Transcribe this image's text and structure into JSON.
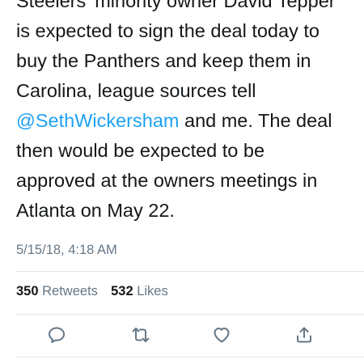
{
  "tweet": {
    "lines": [
      {
        "text": "Steelers' minority owner David Tepper"
      },
      {
        "text": "is expected to sign the deal today to"
      },
      {
        "text": "buy the Panthers and keep them in"
      },
      {
        "text": "Carolina, league sources tell"
      },
      {
        "mention": "@SethWickersham",
        "after": " and me. The deal"
      },
      {
        "text": "then would be expected to be"
      },
      {
        "text": "approved at the owners meetings in"
      },
      {
        "text": "Atlanta on May 22."
      }
    ]
  },
  "timestamp": "5/15/18, 4:18 AM",
  "stats": {
    "retweets_count": "350",
    "retweets_label": "Retweets",
    "likes_count": "532",
    "likes_label": "Likes"
  },
  "actions": {
    "reply_icon": "reply-icon",
    "retweet_icon": "retweet-icon",
    "like_icon": "heart-icon",
    "share_icon": "share-icon"
  },
  "colors": {
    "text": "#14171a",
    "secondary": "#657786",
    "link": "#1da1f2",
    "divider": "#e1e8ed"
  }
}
